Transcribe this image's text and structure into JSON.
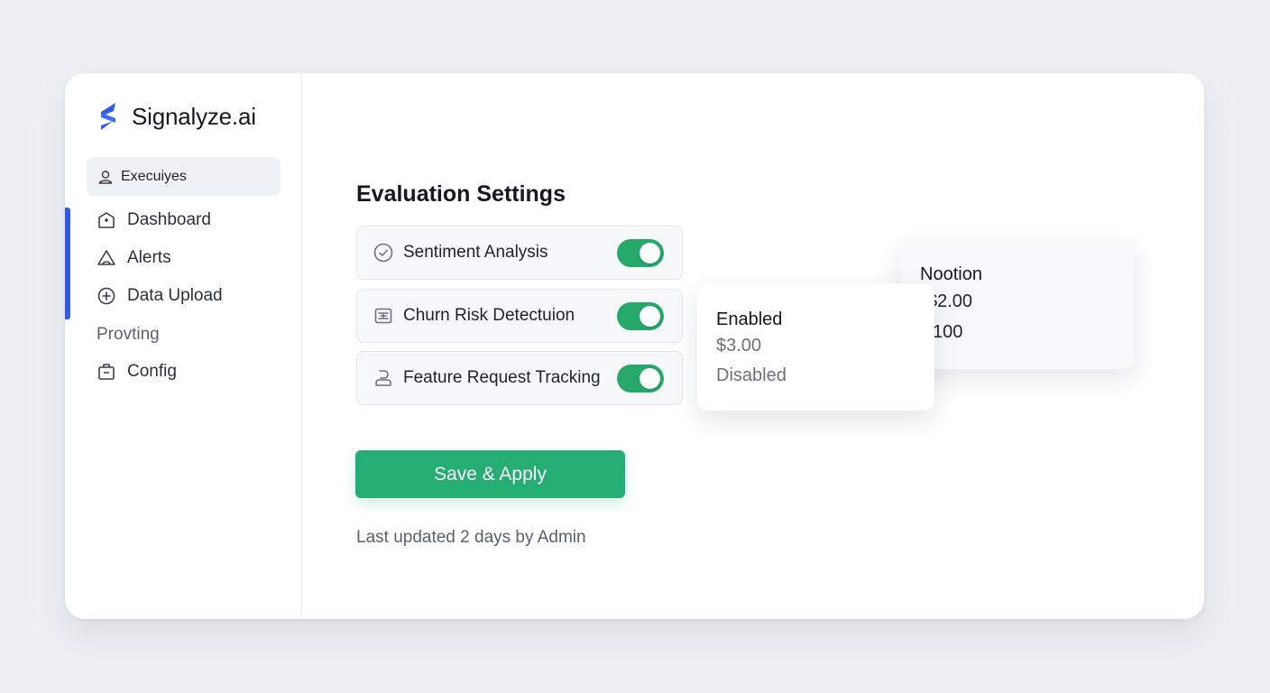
{
  "brand": {
    "name": "Signalyze.ai",
    "accent": "#2f5be6"
  },
  "workspace": {
    "label": "Execuiyes",
    "icon": "user-icon"
  },
  "nav": {
    "items": [
      {
        "label": "Dashboard",
        "icon": "dashboard-icon"
      },
      {
        "label": "Alerts",
        "icon": "alerts-icon"
      },
      {
        "label": "Data Upload",
        "icon": "upload-icon"
      }
    ],
    "section_label": "Provting",
    "config": {
      "label": "Config",
      "icon": "config-icon"
    }
  },
  "main": {
    "title": "Evaluation Settings",
    "settings": [
      {
        "label": "Sentiment Analysis",
        "icon": "check-circle-icon",
        "enabled": true
      },
      {
        "label": "Churn Risk Detectuion",
        "icon": "churn-icon",
        "enabled": true
      },
      {
        "label": "Feature Request Tracking",
        "icon": "feature-request-icon",
        "enabled": true
      }
    ],
    "save_label": "Save & Apply",
    "save_color": "#25ad74",
    "last_updated": "Last updated 2 days by Admin"
  },
  "popover_front": {
    "line1": "Enabled",
    "line2": "$3.00",
    "line3": "Disabled"
  },
  "popover_back": {
    "title": "Nootion",
    "line1": "$2.00",
    "line2": "100"
  },
  "toggle_color": "#27a86b"
}
